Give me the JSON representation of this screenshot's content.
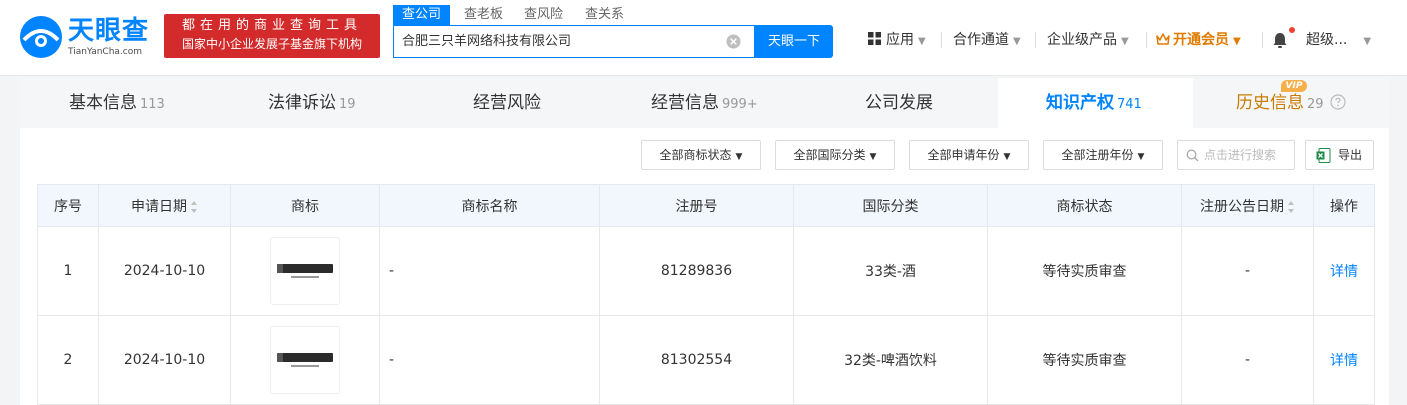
{
  "header": {
    "logo_text": "天眼查",
    "logo_sub": "TianYanCha.com",
    "slogan_line1": "都在用的商业查询工具",
    "slogan_line2": "国家中小企业发展子基金旗下机构",
    "search_tabs": [
      "查公司",
      "查老板",
      "查风险",
      "查关系"
    ],
    "search_value": "合肥三只羊网络科技有限公司",
    "search_button": "天眼一下",
    "nav": {
      "apps": "应用",
      "channel": "合作通道",
      "enterprise": "企业级产品",
      "vip": "开通会员",
      "user": "超级..."
    }
  },
  "tabs": [
    {
      "label": "基本信息",
      "count": "113"
    },
    {
      "label": "法律诉讼",
      "count": "19"
    },
    {
      "label": "经营风险",
      "count": ""
    },
    {
      "label": "经营信息",
      "count": "999+"
    },
    {
      "label": "公司发展",
      "count": ""
    },
    {
      "label": "知识产权",
      "count": "741"
    },
    {
      "label": "历史信息",
      "count": "29"
    }
  ],
  "vip_badge": "VIP",
  "filters": [
    "全部商标状态",
    "全部国际分类",
    "全部申请年份",
    "全部注册年份"
  ],
  "search_placeholder": "点击进行搜索",
  "export_label": "导出",
  "table": {
    "headers": [
      "序号",
      "申请日期",
      "商标",
      "商标名称",
      "注册号",
      "国际分类",
      "商标状态",
      "注册公告日期",
      "操作"
    ],
    "rows": [
      {
        "index": "1",
        "date": "2024-10-10",
        "name": "-",
        "reg_no": "81289836",
        "category": "33类-酒",
        "status": "等待实质审查",
        "announce_date": "-",
        "action": "详情"
      },
      {
        "index": "2",
        "date": "2024-10-10",
        "name": "-",
        "reg_no": "81302554",
        "category": "32类-啤酒饮料",
        "status": "等待实质审查",
        "announce_date": "-",
        "action": "详情"
      }
    ]
  },
  "colors": {
    "brand": "#0084ff",
    "slogan_bg": "#d32b2b",
    "vip": "#e07b00"
  }
}
